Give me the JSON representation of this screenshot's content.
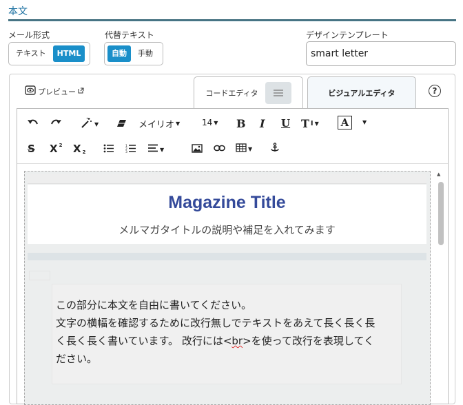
{
  "section": {
    "title": "本文"
  },
  "mail_format": {
    "label": "メール形式",
    "options": [
      "テキスト",
      "HTML"
    ],
    "selected": "HTML"
  },
  "alt_text": {
    "label": "代替テキスト",
    "options": [
      "自動",
      "手動"
    ],
    "selected": "自動"
  },
  "design_template": {
    "label": "デザインテンプレート",
    "value": "smart letter"
  },
  "editor_header": {
    "preview_label": "プレビュー",
    "tabs": [
      {
        "label": "コードエディタ",
        "active": false
      },
      {
        "label": "ビジュアルエディタ",
        "active": true
      }
    ],
    "help": "?"
  },
  "toolbar": {
    "font_name": "メイリオ",
    "font_size": "14",
    "bold": "B",
    "italic": "I",
    "underline": "U",
    "text_style": "T",
    "font_color": "A",
    "strike": "S",
    "superscript": "X",
    "subscript": "X",
    "superscript_mark": "2",
    "subscript_mark": "2",
    "text_style_mark": "I"
  },
  "content": {
    "magazine_title": "Magazine Title",
    "magazine_subtitle": "メルマガタイトルの説明や補足を入れてみます",
    "body_line1": "この部分に本文を自由に書いてください。",
    "body_line2": "文字の横幅を確認するために改行無しでテキストをあえて長く長く長",
    "body_line3_before": "く長く長く書いています。 改行には<",
    "body_line3_br": "br",
    "body_line3_after": ">を使って改行を表現してく",
    "body_line4": "ださい。"
  },
  "colors": {
    "accent": "#1a8fc9",
    "title_blue": "#344a9a",
    "section_rule": "#2c5d6f"
  }
}
